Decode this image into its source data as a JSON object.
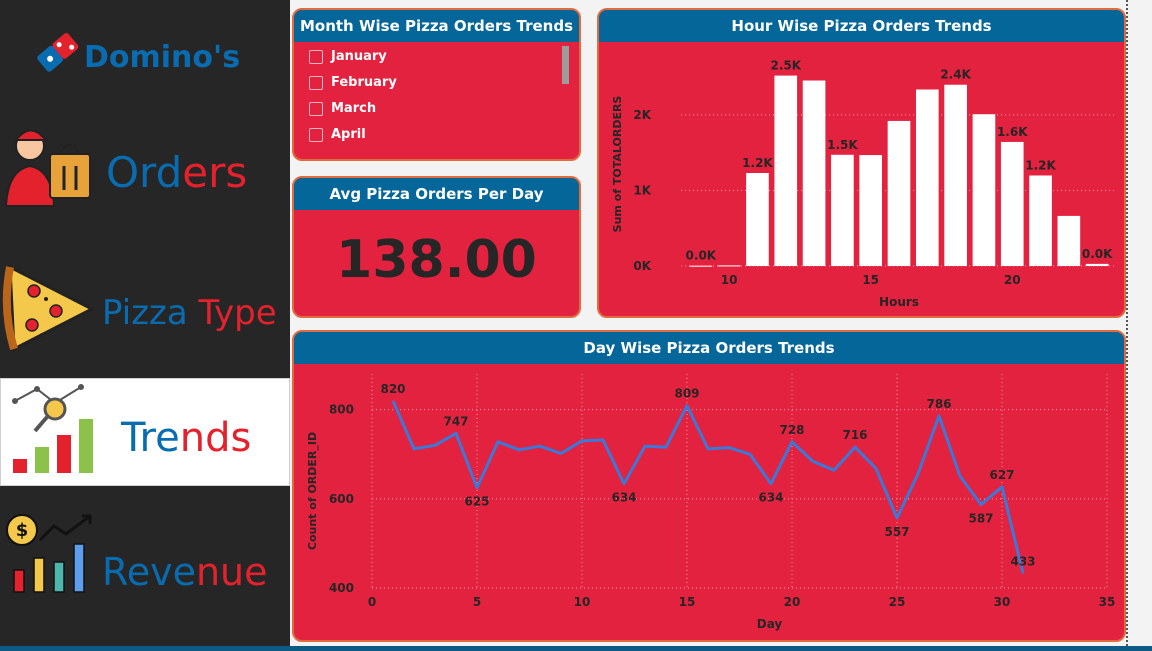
{
  "sidebar": {
    "logo_text": "Domino's",
    "items": [
      {
        "label_a": "Ord",
        "label_b": "ers",
        "key": "orders"
      },
      {
        "label_a": "Pizza",
        "label_b": "Type",
        "key": "pizza-type"
      },
      {
        "label_a": "Tre",
        "label_b": "nds",
        "key": "trends"
      },
      {
        "label_a": "Reve",
        "label_b": "nue",
        "key": "revenue"
      }
    ],
    "icons": [
      "delivery-person-icon",
      "pizza-slice-icon",
      "trend-chart-icon",
      "revenue-chart-icon"
    ]
  },
  "month_slicer": {
    "title": "Month Wise Pizza Orders Trends",
    "options": [
      "January",
      "February",
      "March",
      "April"
    ]
  },
  "kpi": {
    "title": "Avg Pizza Orders Per Day",
    "value": "138.00"
  },
  "hour_chart": {
    "title": "Hour Wise Pizza Orders Trends"
  },
  "day_chart": {
    "title": "Day Wise Pizza Orders Trends"
  },
  "colors": {
    "card_red": "#e3223f",
    "header_blue": "#05669a",
    "card_border": "#e26b3d",
    "sidebar_dark": "#262626",
    "brand_blue": "#0a6cb0",
    "brand_red": "#e3222d",
    "line_blue": "#3c78d8"
  },
  "chart_data": [
    {
      "type": "bar",
      "title": "Hour Wise Pizza Orders Trends",
      "xlabel": "Hours",
      "ylabel": "Sum of TOTALORDERS",
      "x": [
        9,
        10,
        11,
        12,
        13,
        14,
        15,
        16,
        17,
        18,
        19,
        20,
        21,
        22,
        23
      ],
      "values": [
        4,
        8,
        1231,
        2520,
        2455,
        1472,
        1468,
        1920,
        2336,
        2399,
        2009,
        1642,
        1198,
        663,
        28
      ],
      "data_labels": [
        {
          "x": 9,
          "text": "0.0K"
        },
        {
          "x": 11,
          "text": "1.2K"
        },
        {
          "x": 12,
          "text": "2.5K"
        },
        {
          "x": 14,
          "text": "1.5K"
        },
        {
          "x": 18,
          "text": "2.4K"
        },
        {
          "x": 20,
          "text": "1.6K"
        },
        {
          "x": 21,
          "text": "1.2K"
        },
        {
          "x": 23,
          "text": "0.0K"
        }
      ],
      "yticks": [
        {
          "v": 0,
          "t": "0K"
        },
        {
          "v": 1000,
          "t": "1K"
        },
        {
          "v": 2000,
          "t": "2K"
        }
      ],
      "xticks": [
        10,
        15,
        20
      ],
      "ylim": [
        0,
        2700
      ],
      "xlim": [
        8.3,
        23.7
      ],
      "grid": true
    },
    {
      "type": "line",
      "title": "Day Wise Pizza Orders Trends",
      "xlabel": "Day",
      "ylabel": "Count of ORDER_ID",
      "x": [
        1,
        2,
        3,
        4,
        5,
        6,
        7,
        8,
        9,
        10,
        11,
        12,
        13,
        14,
        15,
        16,
        17,
        18,
        19,
        20,
        21,
        22,
        23,
        24,
        25,
        26,
        27,
        28,
        29,
        30,
        31
      ],
      "values": [
        820,
        712,
        720,
        747,
        625,
        728,
        710,
        718,
        702,
        730,
        732,
        634,
        718,
        716,
        809,
        712,
        715,
        700,
        634,
        728,
        684,
        664,
        716,
        668,
        557,
        656,
        786,
        651,
        587,
        627,
        433
      ],
      "data_labels": [
        {
          "x": 1,
          "text": "820"
        },
        {
          "x": 4,
          "text": "747"
        },
        {
          "x": 5,
          "text": "625"
        },
        {
          "x": 12,
          "text": "634"
        },
        {
          "x": 15,
          "text": "809"
        },
        {
          "x": 19,
          "text": "634"
        },
        {
          "x": 20,
          "text": "728"
        },
        {
          "x": 23,
          "text": "716"
        },
        {
          "x": 25,
          "text": "557"
        },
        {
          "x": 27,
          "text": "786"
        },
        {
          "x": 29,
          "text": "587"
        },
        {
          "x": 30,
          "text": "627"
        },
        {
          "x": 31,
          "text": "433"
        }
      ],
      "yticks": [
        400,
        600,
        800
      ],
      "xticks": [
        0,
        5,
        10,
        15,
        20,
        25,
        30,
        35
      ],
      "ylim": [
        400,
        880
      ],
      "xlim": [
        0,
        35
      ],
      "grid": true
    }
  ]
}
